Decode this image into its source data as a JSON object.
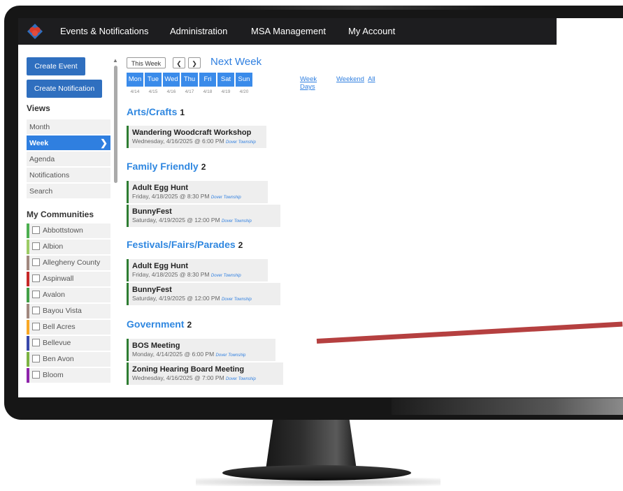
{
  "navbar": {
    "items": [
      "Events & Notifications",
      "Administration",
      "MSA Management",
      "My Account"
    ]
  },
  "sidebar": {
    "create_event": "Create Event",
    "create_notification": "Create Notification",
    "views_heading": "Views",
    "views": [
      "Month",
      "Week",
      "Agenda",
      "Notifications",
      "Search"
    ],
    "active_view": "Week",
    "communities_heading": "My Communities",
    "communities": [
      {
        "name": "Abbottstown",
        "color": "#4caf50"
      },
      {
        "name": "Albion",
        "color": "#9ccc65"
      },
      {
        "name": "Allegheny County",
        "color": "#a1887f"
      },
      {
        "name": "Aspinwall",
        "color": "#c62828"
      },
      {
        "name": "Avalon",
        "color": "#43a047"
      },
      {
        "name": "Bayou Vista",
        "color": "#a1887f"
      },
      {
        "name": "Bell Acres",
        "color": "#f9a825"
      },
      {
        "name": "Bellevue",
        "color": "#3949ab"
      },
      {
        "name": "Ben Avon",
        "color": "#7cb342"
      },
      {
        "name": "Bloom",
        "color": "#8e24aa"
      }
    ]
  },
  "week_nav": {
    "this_week": "This Week",
    "prev_icon": "chevron-left-icon",
    "next_icon": "chevron-right-icon",
    "title": "Next Week",
    "days": [
      {
        "label": "Mon",
        "date": "4/14"
      },
      {
        "label": "Tue",
        "date": "4/15"
      },
      {
        "label": "Wed",
        "date": "4/16"
      },
      {
        "label": "Thu",
        "date": "4/17"
      },
      {
        "label": "Fri",
        "date": "4/18"
      },
      {
        "label": "Sat",
        "date": "4/19"
      },
      {
        "label": "Sun",
        "date": "4/20"
      }
    ],
    "filters": [
      "Week Days",
      "Weekend",
      "All"
    ]
  },
  "categories": [
    {
      "name": "Arts/Crafts",
      "count": "1",
      "events": [
        {
          "title": "Wandering Woodcraft Workshop",
          "when": "Wednesday, 4/16/2025 @ 6:00 PM",
          "location": "Dover Township"
        }
      ]
    },
    {
      "name": "Family Friendly",
      "count": "2",
      "events": [
        {
          "title": "Adult Egg Hunt",
          "when": "Friday, 4/18/2025 @ 8:30 PM",
          "location": "Dover Township"
        },
        {
          "title": "BunnyFest",
          "when": "Saturday, 4/19/2025 @ 12:00 PM",
          "location": "Dover Township"
        }
      ]
    },
    {
      "name": "Festivals/Fairs/Parades",
      "count": "2",
      "events": [
        {
          "title": "Adult Egg Hunt",
          "when": "Friday, 4/18/2025 @ 8:30 PM",
          "location": "Dover Township"
        },
        {
          "title": "BunnyFest",
          "when": "Saturday, 4/19/2025 @ 12:00 PM",
          "location": "Dover Township"
        }
      ]
    },
    {
      "name": "Government",
      "count": "2",
      "events": [
        {
          "title": "BOS Meeting",
          "when": "Monday, 4/14/2025 @ 6:00 PM",
          "location": "Dover Township"
        },
        {
          "title": "Zoning Hearing Board Meeting",
          "when": "Wednesday, 4/16/2025 @ 7:00 PM",
          "location": "Dover Township"
        }
      ]
    }
  ],
  "colors": {
    "accent": "#2f7fe0",
    "event_bar": "#2e7d32",
    "pointer": "#b54040"
  }
}
